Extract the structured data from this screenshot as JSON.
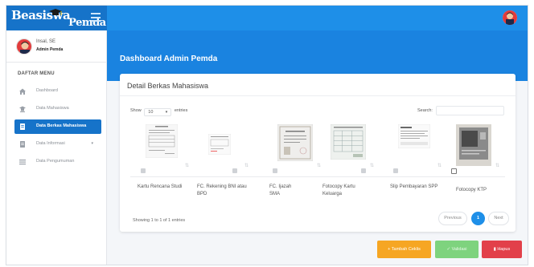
{
  "brand": {
    "line1": "Beasiswa",
    "line2": "Pemda"
  },
  "user": {
    "name": "Insal, SE",
    "role": "Admin Pemda"
  },
  "sidebar": {
    "title": "DAFTAR MENU",
    "items": [
      {
        "label": "Dashboard",
        "icon": "home-icon"
      },
      {
        "label": "Data Mahasiswa",
        "icon": "graduation-cap-icon"
      },
      {
        "label": "Data Berkas Mahasiswa",
        "icon": "file-icon",
        "active": true
      },
      {
        "label": "Data Informasi",
        "icon": "document-icon",
        "caret": "▾"
      },
      {
        "label": "Data Pengumuman",
        "icon": "list-icon"
      }
    ]
  },
  "header": {
    "title": "Dashboard Admin Pemda"
  },
  "card": {
    "title": "Detail Berkas Mahasiswa",
    "show_label": "Show",
    "entries_value": "10",
    "entries_label": "entries",
    "search_label": "Search:",
    "search_value": "",
    "columns": [
      {
        "label": "Kartu Rencana Studi"
      },
      {
        "label": "FC. Rekening BNI atau BPD"
      },
      {
        "label": "FC. Ijazah SMA"
      },
      {
        "label": "Fotocopy Kartu Keluarga"
      },
      {
        "label": "Slip Pembayaran SPP"
      },
      {
        "label": "Fotocopy KTP"
      }
    ],
    "showing_text": "Showing 1 to 1 of 1 entries",
    "pager": {
      "previous": "Previous",
      "page": "1",
      "next": "Next"
    }
  },
  "actions": {
    "add": "+ Tambah Ceklis",
    "valid": "✓ Validasi",
    "delete": "Hapus"
  },
  "colors": {
    "topbar": "#1e8fe8",
    "brand": "#1673c9",
    "active_menu": "#1673c9",
    "add_button": "#f6a623",
    "valid_button": "#7ed37e",
    "delete_button": "#e2404a"
  }
}
